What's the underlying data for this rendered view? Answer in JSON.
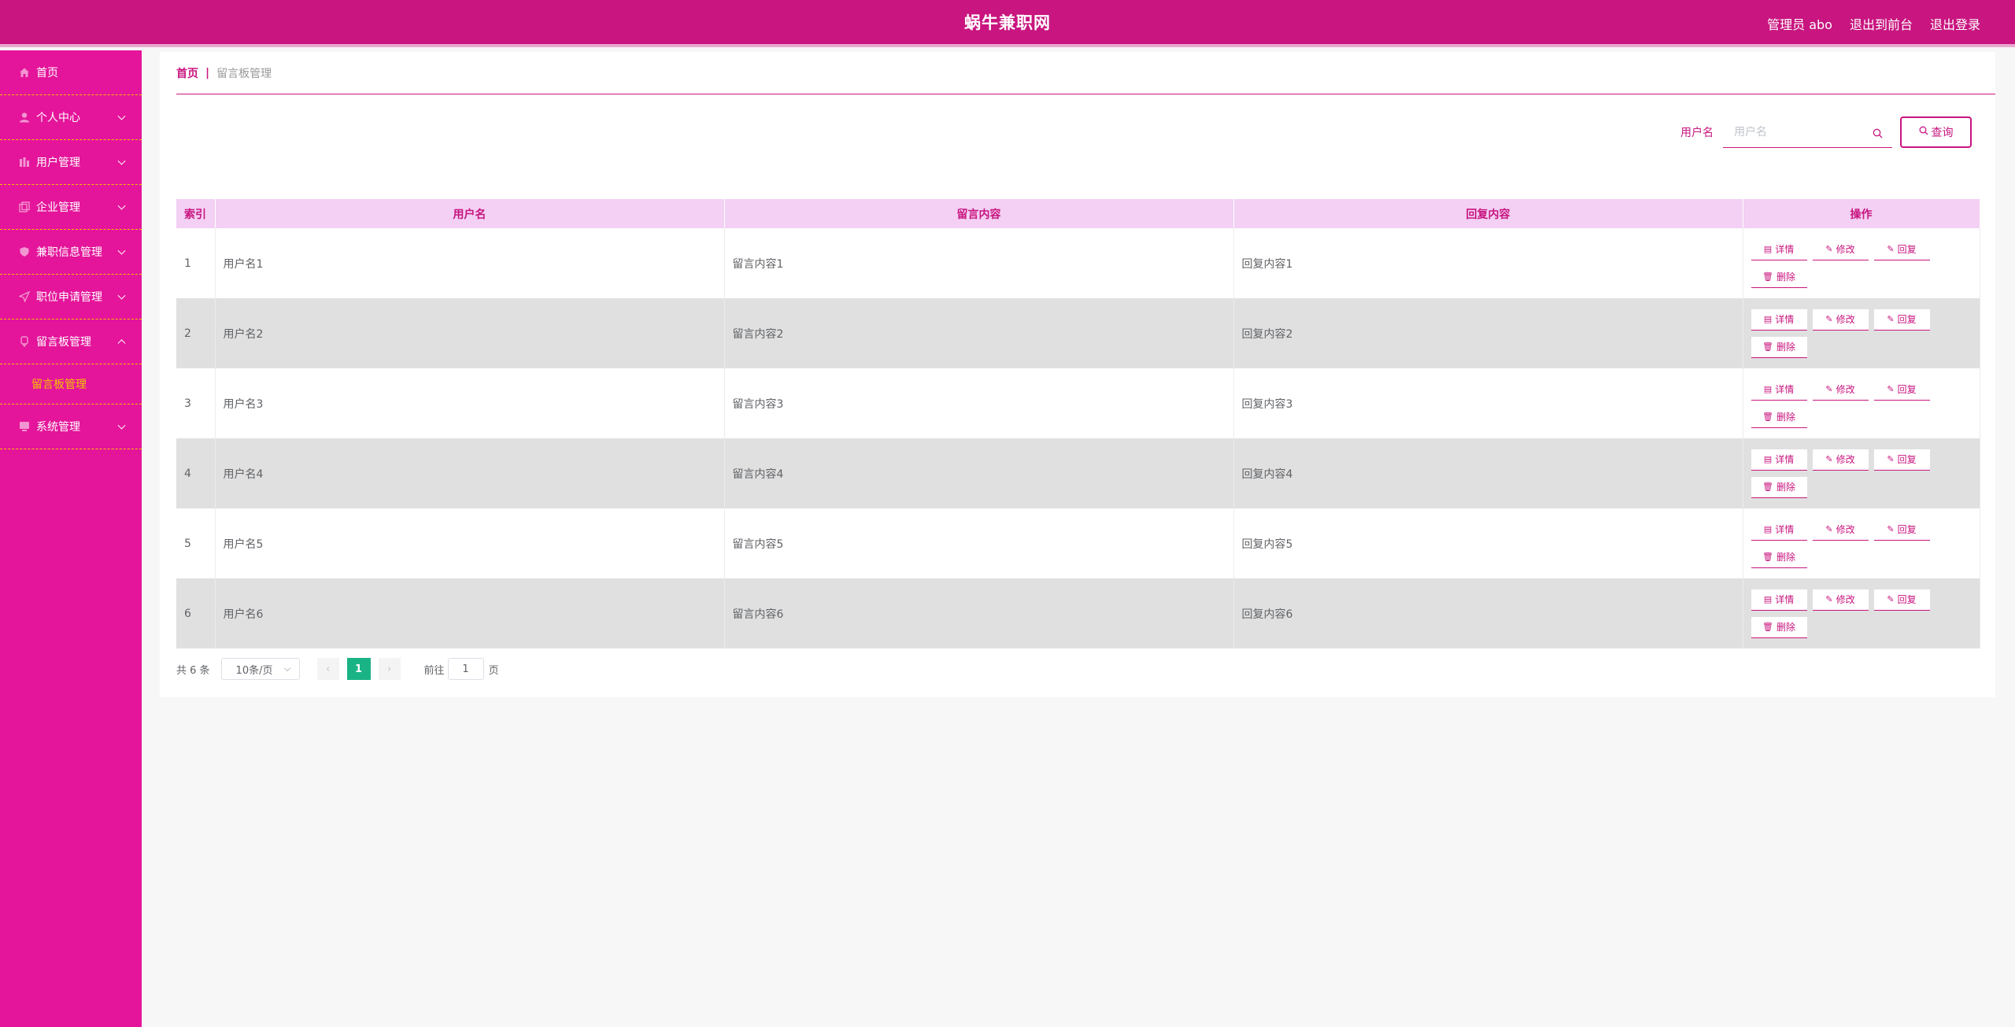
{
  "header": {
    "title": "蜗牛兼职网",
    "user_label": "管理员 abo",
    "to_front": "退出到前台",
    "logout": "退出登录"
  },
  "sidebar": {
    "items": [
      {
        "label": "首页",
        "icon": "home-icon"
      },
      {
        "label": "个人中心",
        "icon": "user-icon"
      },
      {
        "label": "用户管理",
        "icon": "users-icon"
      },
      {
        "label": "企业管理",
        "icon": "company-icon"
      },
      {
        "label": "兼职信息管理",
        "icon": "job-icon"
      },
      {
        "label": "职位申请管理",
        "icon": "send-icon"
      },
      {
        "label": "留言板管理",
        "icon": "message-icon"
      },
      {
        "label": "系统管理",
        "icon": "system-icon"
      }
    ],
    "submenu_active": "留言板管理"
  },
  "breadcrumb": {
    "home": "首页",
    "sep": "|",
    "current": "留言板管理"
  },
  "search": {
    "label": "用户名",
    "placeholder": "用户名",
    "button": "查询"
  },
  "table": {
    "headers": [
      "索引",
      "用户名",
      "留言内容",
      "回复内容",
      "操作"
    ],
    "rows": [
      {
        "index": "1",
        "username": "用户名1",
        "message": "留言内容1",
        "reply": "回复内容1"
      },
      {
        "index": "2",
        "username": "用户名2",
        "message": "留言内容2",
        "reply": "回复内容2"
      },
      {
        "index": "3",
        "username": "用户名3",
        "message": "留言内容3",
        "reply": "回复内容3"
      },
      {
        "index": "4",
        "username": "用户名4",
        "message": "留言内容4",
        "reply": "回复内容4"
      },
      {
        "index": "5",
        "username": "用户名5",
        "message": "留言内容5",
        "reply": "回复内容5"
      },
      {
        "index": "6",
        "username": "用户名6",
        "message": "留言内容6",
        "reply": "回复内容6"
      }
    ],
    "actions": {
      "detail": "详情",
      "edit": "修改",
      "reply": "回复",
      "delete": "删除"
    }
  },
  "pagination": {
    "total": "共 6 条",
    "page_size": "10条/页",
    "current_page": "1",
    "goto_label": "前往",
    "goto_value": "1",
    "page_suffix": "页"
  },
  "colors": {
    "primary": "#c8157f",
    "sidebar": "#e4159a",
    "active_sub": "#f5c300",
    "header_row": "#f3d0f4"
  }
}
